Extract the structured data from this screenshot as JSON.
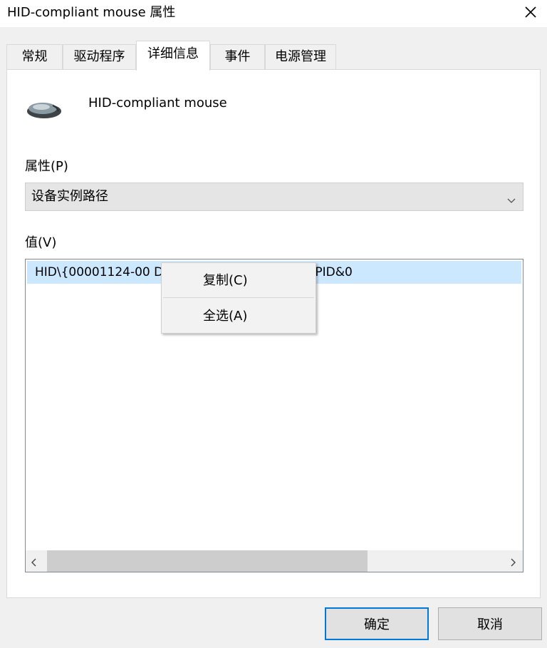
{
  "window": {
    "title": "HID-compliant mouse 属性",
    "close_icon": "close-icon"
  },
  "tabs": [
    {
      "label": "常规"
    },
    {
      "label": "驱动程序"
    },
    {
      "label": "详细信息",
      "active": true
    },
    {
      "label": "事件"
    },
    {
      "label": "电源管理"
    }
  ],
  "device": {
    "icon": "mouse-icon",
    "name": "HID-compliant mouse"
  },
  "property": {
    "label": "属性(P)",
    "selected": "设备实例路径"
  },
  "value": {
    "label": "值(V)",
    "items": [
      "HID\\{00001124-00                              DB34FB}_VID&0001004C_PID&0"
    ]
  },
  "context_menu": {
    "items": [
      {
        "label": "复制(C)"
      },
      {
        "label": "全选(A)"
      }
    ]
  },
  "buttons": {
    "ok": "确定",
    "cancel": "取消"
  },
  "colors": {
    "selection": "#cce8ff",
    "accent": "#0078d7"
  }
}
